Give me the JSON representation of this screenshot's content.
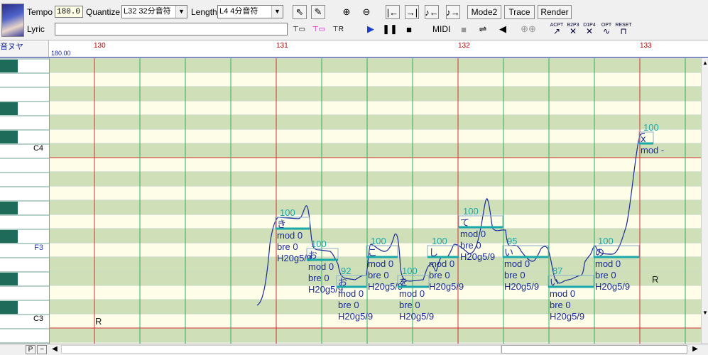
{
  "toolbar": {
    "tempo_label": "Tempo",
    "tempo_value": "180.0",
    "quantize_label": "Quantize",
    "quantize_value": "L32 32分音符",
    "length_label": "Length",
    "length_value": "L4  4分音符",
    "lyric_label": "Lyric",
    "lyric_value": "",
    "mode2_label": "Mode2",
    "trace_label": "Trace",
    "render_label": "Render",
    "midi_label": "MIDI",
    "effect_icons": [
      {
        "name": "acpt-icon",
        "text": "ACPT"
      },
      {
        "name": "b2p3-icon",
        "text": "B2P3"
      },
      {
        "name": "d1p4-icon",
        "text": "D1P4"
      },
      {
        "name": "opt-icon",
        "text": "OPT"
      },
      {
        "name": "reset-icon",
        "text": "RESET"
      }
    ]
  },
  "ruler": {
    "corner_label": "音ヌヤ",
    "tempo_marker": "180.00",
    "measures": [
      "130",
      "131",
      "132",
      "133"
    ]
  },
  "piano": {
    "labels": [
      "C4",
      "F3",
      "C3"
    ]
  },
  "notes": [
    {
      "lyric": "き",
      "velocity": "100",
      "params": [
        "mod 0",
        "bre 0",
        "H20g5/9"
      ]
    },
    {
      "lyric": "お",
      "velocity": "100",
      "params": [
        "mod 0",
        "bre 0",
        "H20g5/9"
      ]
    },
    {
      "lyric": "お",
      "velocity": "92",
      "params": [
        "mod 0",
        "bre 0",
        "H20g5/9"
      ]
    },
    {
      "lyric": "こ",
      "velocity": "100",
      "params": [
        "mod 0",
        "bre 0",
        "H20g5/9"
      ]
    },
    {
      "lyric": "を",
      "velocity": "100",
      "params": [
        "mod 0",
        "bre 0",
        "H20g5/9"
      ]
    },
    {
      "lyric": "し",
      "velocity": "100",
      "params": [
        "mod 0",
        "bre 0",
        "H20g5/9"
      ]
    },
    {
      "lyric": "て",
      "velocity": "100",
      "params": [
        "mod 0",
        "bre 0",
        "H20g5/9"
      ]
    },
    {
      "lyric": "い",
      "velocity": "95",
      "params": [
        "mod 0",
        "bre 0",
        "H20g5/9"
      ]
    },
    {
      "lyric": "い",
      "velocity": "87",
      "params": [
        "mod 0",
        "bre 0",
        "H20g5/9"
      ]
    },
    {
      "lyric": "の",
      "velocity": "100",
      "params": [
        "mod 0",
        "bre 0",
        "H20g5/9"
      ]
    },
    {
      "lyric": "x",
      "velocity": "100",
      "params": [
        "mod -"
      ]
    }
  ],
  "rests": [
    "R",
    "R"
  ],
  "statusbar": {
    "p_label": "P",
    "tilde_label": "~"
  }
}
